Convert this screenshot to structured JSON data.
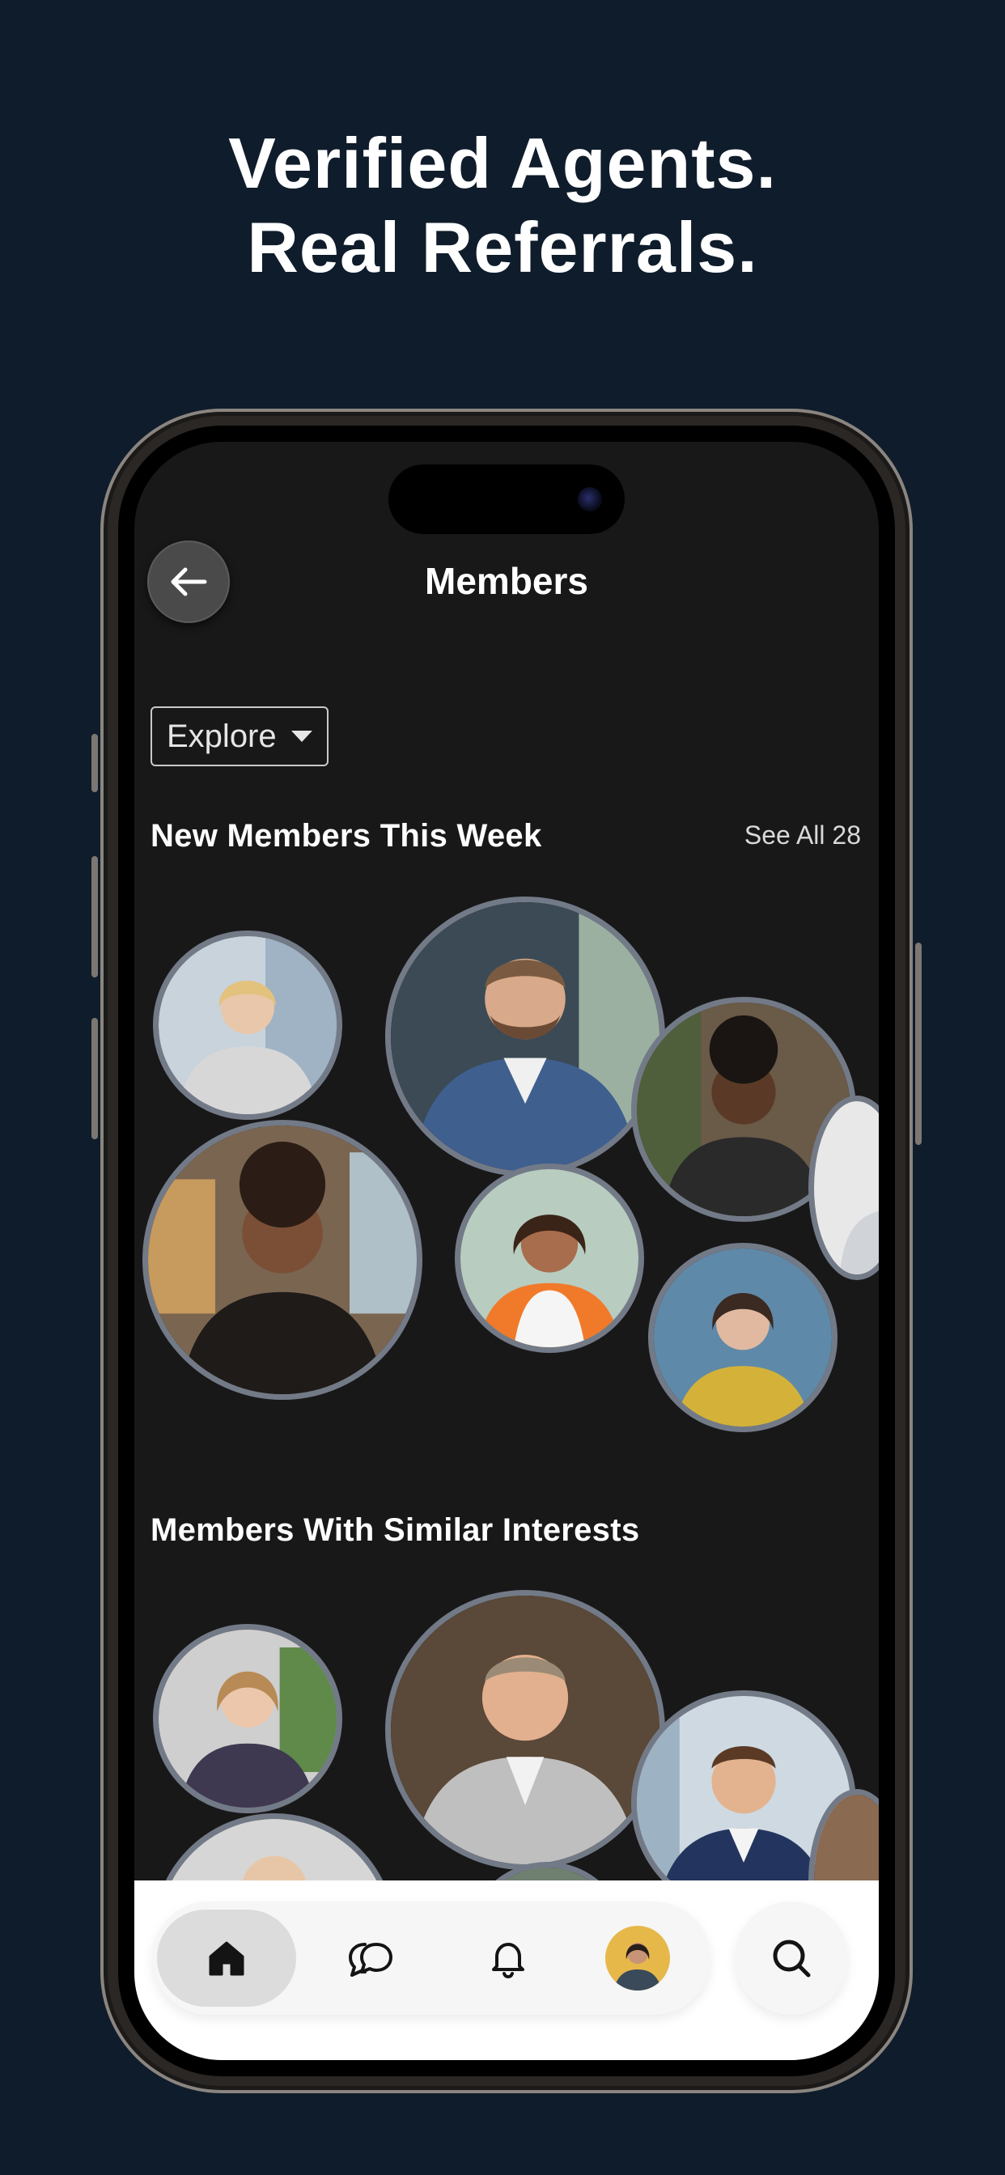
{
  "headline": {
    "line1": "Verified Agents.",
    "line2": "Real Referrals."
  },
  "screen": {
    "title": "Members",
    "explore_label": "Explore",
    "section_new": "New Members This Week",
    "see_all": "See All 28",
    "section_similar": "Members With Similar Interests"
  },
  "icons": {
    "back": "arrow-left-icon",
    "explore_caret": "caret-down-icon",
    "home": "home-icon",
    "chat": "chat-bubbles-icon",
    "bell": "bell-icon",
    "profile": "profile-avatar",
    "search": "search-icon"
  },
  "colors": {
    "background": "#0f1c2b",
    "screen": "#181818",
    "bubble_ring": "#737a87",
    "tabbar": "#ffffff"
  }
}
